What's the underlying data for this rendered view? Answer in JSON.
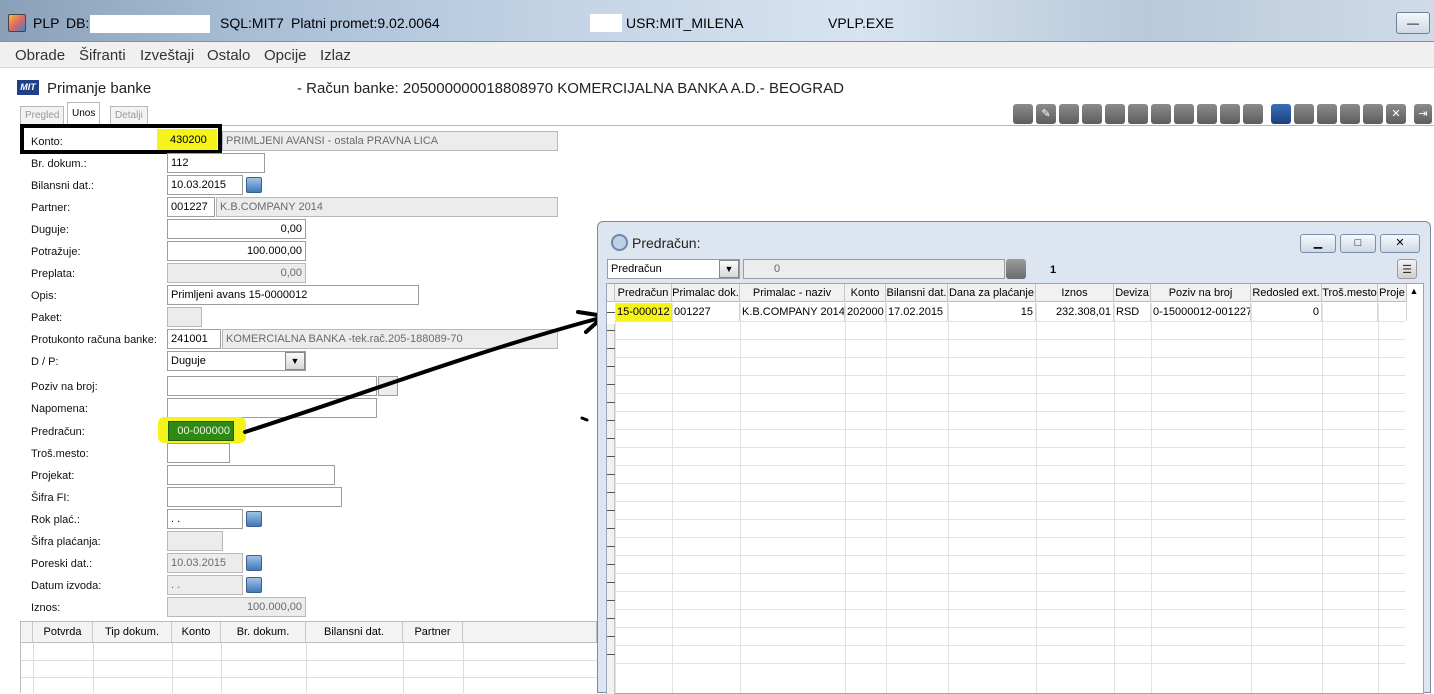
{
  "titlebar": {
    "app": "PLP",
    "db_label": "DB:N",
    "sql": "SQL:MIT7",
    "version": "Platni promet:9.02.0064",
    "user": "USR:MIT_MILENA",
    "exe": "VPLP.EXE",
    "minimize": "—"
  },
  "menu": [
    "Obrade",
    "Šifranti",
    "Izveštaji",
    "Ostalo",
    "Opcije",
    "Izlaz"
  ],
  "form": {
    "logo": "MIT",
    "title": "Primanje banke",
    "subtitle": "- Račun banke: 205000000018808970  KOMERCIJALNA BANKA A.D.- BEOGRAD"
  },
  "tabs": [
    "Pregled",
    "Unos",
    "Detalji"
  ],
  "fields": {
    "konto": {
      "label": "Konto:",
      "value": "430200",
      "desc": "PRIMLJENI AVANSI - ostala PRAVNA LICA"
    },
    "br_dokum": {
      "label": "Br. dokum.:",
      "value": "112"
    },
    "bilansni_dat": {
      "label": "Bilansni dat.:",
      "value": "10.03.2015"
    },
    "partner": {
      "label": "Partner:",
      "value": "001227",
      "desc": "K.B.COMPANY 2014"
    },
    "duguje": {
      "label": "Duguje:",
      "value": "0,00"
    },
    "potrazuje": {
      "label": "Potražuje:",
      "value": "100.000,00"
    },
    "preplata": {
      "label": "Preplata:",
      "value": "0,00"
    },
    "opis": {
      "label": "Opis:",
      "value": "Primljeni avans 15-0000012"
    },
    "paket": {
      "label": "Paket:",
      "value": ""
    },
    "protukonto": {
      "label": "Protukonto računa banke:",
      "value": "241001",
      "desc": "KOMERCIALNA BANKA -tek.rač.205-188089-70"
    },
    "dp": {
      "label": "D / P:",
      "value": "Duguje"
    },
    "poziv": {
      "label": "Poziv na broj:",
      "value": ""
    },
    "napomena": {
      "label": "Napomena:",
      "value": ""
    },
    "predracun": {
      "label": "Predračun:",
      "value": "00-000000"
    },
    "tros_mesto": {
      "label": "Troš.mesto:",
      "value": ""
    },
    "projekat": {
      "label": "Projekat:",
      "value": ""
    },
    "sifra_fi": {
      "label": "Šifra FI:",
      "value": ""
    },
    "rok_plac": {
      "label": "Rok plać.:",
      "value": " .  ."
    },
    "sifra_placanja": {
      "label": "Šifra plaćanja:",
      "value": ""
    },
    "poreski_dat": {
      "label": "Poreski dat.:",
      "value": "10.03.2015"
    },
    "datum_izvoda": {
      "label": "Datum izvoda:",
      "value": " .  ."
    },
    "iznos": {
      "label": "Iznos:",
      "value": "100.000,00"
    }
  },
  "bottom_grid": {
    "columns": [
      "Potvrda",
      "Tip dokum.",
      "Konto",
      "Br. dokum.",
      "Bilansni dat.",
      "Partner"
    ]
  },
  "popup": {
    "title": "Predračun:",
    "combo_value": "Predračun",
    "search_value": "0",
    "count": "1",
    "columns": [
      "Predračun",
      "Primalac dok.",
      "Primalac - naziv",
      "Konto",
      "Bilansni dat.",
      "Dana za plaćanje",
      "Iznos",
      "Deviza",
      "Poziv na broj",
      "Redosled ext.",
      "Troš.mesto",
      "Proje"
    ],
    "rows": [
      [
        "15-000012",
        "001227",
        "K.B.COMPANY 2014",
        "202000",
        "17.02.2015",
        "15",
        "232.308,01",
        "RSD",
        "0-15000012-001227",
        "0",
        "",
        ""
      ]
    ]
  }
}
